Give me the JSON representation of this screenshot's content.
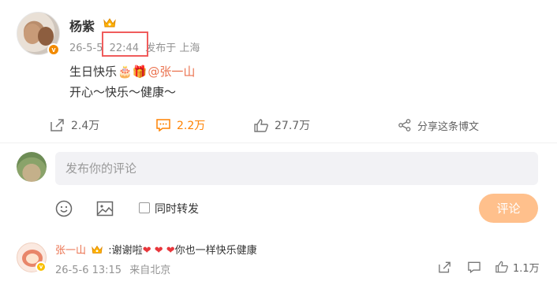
{
  "post": {
    "author": "杨紫",
    "date": "26-5-5",
    "time": "22:44",
    "location": "发布于 上海",
    "text_line1_prefix": "生日快乐",
    "text_line1_emoji": "🎂🎁",
    "mention": "@张一山",
    "text_line2": "开心～快乐～健康～",
    "verified_badge": "v"
  },
  "actions": {
    "share_count": "2.4万",
    "comment_count": "2.2万",
    "like_count": "27.7万",
    "forward_label": "分享这条博文"
  },
  "composer": {
    "placeholder": "发布你的评论",
    "repost_label": "同时转发",
    "submit_label": "评论"
  },
  "reply": {
    "author": "张一山",
    "text_prefix": ":谢谢啦",
    "hearts": "❤ ❤ ❤",
    "text_suffix": "你也一样快乐健康",
    "time": "26-5-6 13:15",
    "source": "来自北京",
    "like_count": "1.1万"
  },
  "colors": {
    "accent_orange": "#ff8200",
    "mention": "#eb7350",
    "highlight_box": "#f05c5c",
    "submit_button": "#ffc08c"
  },
  "icons": [
    "crown-icon",
    "share-icon",
    "comment-icon",
    "like-icon",
    "forward-icon",
    "emoji-icon",
    "image-icon",
    "checkbox",
    "heart-icon"
  ]
}
